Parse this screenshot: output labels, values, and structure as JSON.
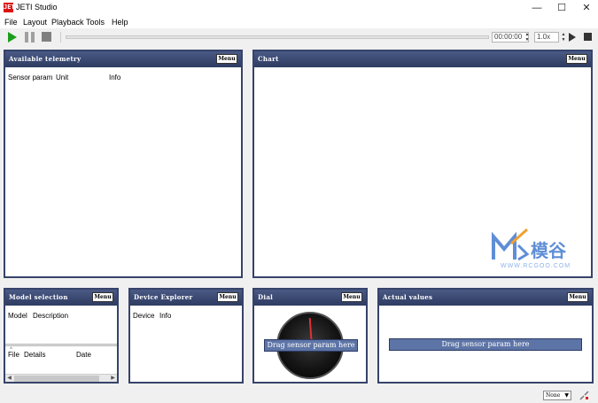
{
  "window": {
    "title": "JETI Studio",
    "icon_label": "JETI"
  },
  "menubar": [
    "File",
    "Layout",
    "Playback",
    "Tools",
    "Help"
  ],
  "toolbar": {
    "time": "00:00:00",
    "speed": "1.0x",
    "progress": 0.0
  },
  "panels": {
    "telemetry": {
      "title": "Available telemetry",
      "menu": "Menu",
      "columns": [
        "Sensor param",
        "Unit",
        "Info"
      ]
    },
    "chart": {
      "title": "Chart",
      "menu": "Menu"
    },
    "model": {
      "title": "Model selection",
      "menu": "Menu",
      "columns": [
        "Model",
        "Description"
      ],
      "file_columns": [
        "File",
        "Details",
        "Date"
      ]
    },
    "device": {
      "title": "Device Explorer",
      "menu": "Menu",
      "columns": [
        "Device",
        "Info"
      ]
    },
    "dial": {
      "title": "Dial",
      "menu": "Menu",
      "drop_text": "Drag sensor param here"
    },
    "actual": {
      "title": "Actual values",
      "menu": "Menu",
      "drop_text": "Drag sensor param here"
    }
  },
  "watermark": {
    "brand": "模谷",
    "url": "WWW.RCGOO.COM"
  },
  "statusbar": {
    "select_value": "None"
  },
  "colors": {
    "panel_header": "#36436a",
    "drop_zone": "#5d74a6",
    "play_green": "#1a9e1a",
    "app_icon": "#dd1111",
    "watermark": "#5f8ed6"
  }
}
